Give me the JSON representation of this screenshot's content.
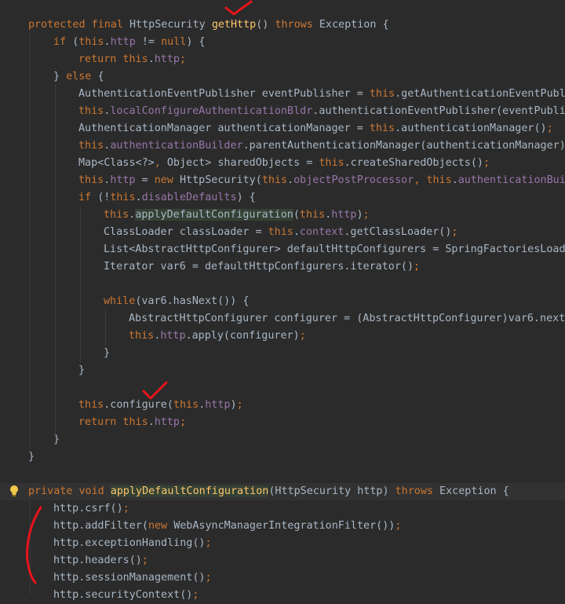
{
  "editor": {
    "lines": [
      [
        {
          "t": "protected final ",
          "c": "kw"
        },
        {
          "t": "HttpSecurity "
        },
        {
          "t": "getHttp",
          "c": "fn"
        },
        {
          "t": "() "
        },
        {
          "t": "throws ",
          "c": "kw"
        },
        {
          "t": "Exception {"
        }
      ],
      [
        {
          "t": "if ",
          "c": "kw"
        },
        {
          "t": "("
        },
        {
          "t": "this",
          "c": "kw"
        },
        {
          "t": "."
        },
        {
          "t": "http",
          "c": "field"
        },
        {
          "t": " != "
        },
        {
          "t": "null",
          "c": "kw"
        },
        {
          "t": ") {"
        }
      ],
      [
        {
          "t": "return this",
          "c": "kw"
        },
        {
          "t": "."
        },
        {
          "t": "http",
          "c": "field"
        },
        {
          "t": ";",
          "c": "kw"
        }
      ],
      [
        {
          "t": "} "
        },
        {
          "t": "else ",
          "c": "kw"
        },
        {
          "t": "{"
        }
      ],
      [
        {
          "t": "AuthenticationEventPublisher eventPublisher = "
        },
        {
          "t": "this",
          "c": "kw"
        },
        {
          "t": ".getAuthenticationEventPubli"
        }
      ],
      [
        {
          "t": "this",
          "c": "kw"
        },
        {
          "t": "."
        },
        {
          "t": "localConfigureAuthenticationBldr",
          "c": "field"
        },
        {
          "t": ".authenticationEventPublisher(eventPublis"
        }
      ],
      [
        {
          "t": "AuthenticationManager authenticationManager = "
        },
        {
          "t": "this",
          "c": "kw"
        },
        {
          "t": ".authenticationManager()"
        },
        {
          "t": ";",
          "c": "kw"
        }
      ],
      [
        {
          "t": "this",
          "c": "kw"
        },
        {
          "t": "."
        },
        {
          "t": "authenticationBuilder",
          "c": "field"
        },
        {
          "t": ".parentAuthenticationManager(authenticationManager)"
        },
        {
          "t": ";",
          "c": "kw"
        }
      ],
      [
        {
          "t": "Map<Class<?>"
        },
        {
          "t": ", ",
          "c": "kw"
        },
        {
          "t": "Object> sharedObjects = "
        },
        {
          "t": "this",
          "c": "kw"
        },
        {
          "t": ".createSharedObjects()"
        },
        {
          "t": ";",
          "c": "kw"
        }
      ],
      [
        {
          "t": "this",
          "c": "kw"
        },
        {
          "t": "."
        },
        {
          "t": "http",
          "c": "field"
        },
        {
          "t": " = "
        },
        {
          "t": "new ",
          "c": "kw"
        },
        {
          "t": "HttpSecurity("
        },
        {
          "t": "this",
          "c": "kw"
        },
        {
          "t": "."
        },
        {
          "t": "objectPostProcessor",
          "c": "field"
        },
        {
          "t": ", ",
          "c": "kw"
        },
        {
          "t": "this",
          "c": "kw"
        },
        {
          "t": "."
        },
        {
          "t": "authenticationBuil",
          "c": "field"
        }
      ],
      [
        {
          "t": "if ",
          "c": "kw"
        },
        {
          "t": "(!"
        },
        {
          "t": "this",
          "c": "kw"
        },
        {
          "t": "."
        },
        {
          "t": "disableDefaults",
          "c": "field"
        },
        {
          "t": ") {"
        }
      ],
      [
        {
          "t": "this",
          "c": "kw"
        },
        {
          "t": "."
        },
        {
          "t": "applyDefaultConfiguration",
          "c": "hlbox"
        },
        {
          "t": "("
        },
        {
          "t": "this",
          "c": "kw"
        },
        {
          "t": "."
        },
        {
          "t": "http",
          "c": "field"
        },
        {
          "t": ")"
        },
        {
          "t": ";",
          "c": "kw"
        }
      ],
      [
        {
          "t": "ClassLoader classLoader = "
        },
        {
          "t": "this",
          "c": "kw"
        },
        {
          "t": "."
        },
        {
          "t": "context",
          "c": "field"
        },
        {
          "t": ".getClassLoader()"
        },
        {
          "t": ";",
          "c": "kw"
        }
      ],
      [
        {
          "t": "List<AbstractHttpConfigurer> defaultHttpConfigurers = SpringFactoriesLoade"
        }
      ],
      [
        {
          "t": "Iterator var6 = defaultHttpConfigurers.iterator()"
        },
        {
          "t": ";",
          "c": "kw"
        }
      ],
      [],
      [
        {
          "t": "while",
          "c": "kw"
        },
        {
          "t": "(var6.hasNext()) {"
        }
      ],
      [
        {
          "t": "AbstractHttpConfigurer configurer = (AbstractHttpConfigurer)var6.next("
        }
      ],
      [
        {
          "t": "this",
          "c": "kw"
        },
        {
          "t": "."
        },
        {
          "t": "http",
          "c": "field"
        },
        {
          "t": ".apply(configurer)"
        },
        {
          "t": ";",
          "c": "kw"
        }
      ],
      [
        {
          "t": "}"
        }
      ],
      [
        {
          "t": "}"
        }
      ],
      [],
      [
        {
          "t": "this",
          "c": "kw"
        },
        {
          "t": ".configure("
        },
        {
          "t": "this",
          "c": "kw"
        },
        {
          "t": "."
        },
        {
          "t": "http",
          "c": "field"
        },
        {
          "t": ")"
        },
        {
          "t": ";",
          "c": "kw"
        }
      ],
      [
        {
          "t": "return this",
          "c": "kw"
        },
        {
          "t": "."
        },
        {
          "t": "http",
          "c": "field"
        },
        {
          "t": ";",
          "c": "kw"
        }
      ],
      [
        {
          "t": "}"
        }
      ],
      [
        {
          "t": "}"
        }
      ],
      [],
      [
        {
          "t": "private void ",
          "c": "kw"
        },
        {
          "t": "applyDefaultConfiguration",
          "c": "fn hlbox"
        },
        {
          "t": "(HttpSecurity http) "
        },
        {
          "t": "throws ",
          "c": "kw"
        },
        {
          "t": "Exception {"
        }
      ],
      [
        {
          "t": "http.csrf()"
        },
        {
          "t": ";",
          "c": "kw"
        }
      ],
      [
        {
          "t": "http.addFilter("
        },
        {
          "t": "new ",
          "c": "kw"
        },
        {
          "t": "WebAsyncManagerIntegrationFilter())"
        },
        {
          "t": ";",
          "c": "kw"
        }
      ],
      [
        {
          "t": "http.exceptionHandling()"
        },
        {
          "t": ";",
          "c": "kw"
        }
      ],
      [
        {
          "t": "http.headers()"
        },
        {
          "t": ";",
          "c": "kw"
        }
      ],
      [
        {
          "t": "http.sessionManagement()"
        },
        {
          "t": ";",
          "c": "kw"
        }
      ],
      [
        {
          "t": "http.securityContext()"
        },
        {
          "t": ";",
          "c": "kw"
        }
      ]
    ]
  },
  "icons": {
    "gutter": "lightbulb-icon"
  },
  "annotations": [
    "red-checkmark",
    "red-checkmark",
    "red-bracket"
  ],
  "colors": {
    "background": "#2b2b2b",
    "keyword": "#cc7832",
    "method": "#ffc66d",
    "field": "#9876aa",
    "text": "#a9b7c6",
    "annotation": "#e8141c"
  }
}
